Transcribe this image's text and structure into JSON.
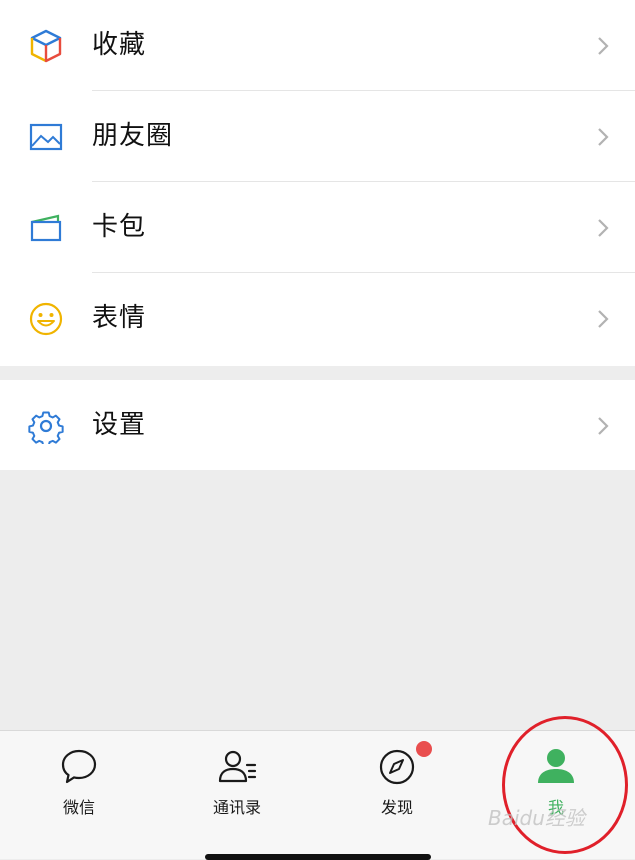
{
  "menu_group_1": [
    {
      "label": "收藏",
      "icon": "cube-icon"
    },
    {
      "label": "朋友圈",
      "icon": "image-icon"
    },
    {
      "label": "卡包",
      "icon": "card-icon"
    },
    {
      "label": "表情",
      "icon": "smiley-icon"
    }
  ],
  "menu_group_2": [
    {
      "label": "设置",
      "icon": "gear-icon"
    }
  ],
  "tabbar": {
    "tabs": [
      {
        "label": "微信",
        "icon": "chat-bubble-icon"
      },
      {
        "label": "通讯录",
        "icon": "contacts-icon"
      },
      {
        "label": "发现",
        "icon": "compass-icon",
        "badge": true
      },
      {
        "label": "我",
        "icon": "person-icon",
        "active": true
      }
    ]
  },
  "watermark": "Baidu经验",
  "colors": {
    "active_green": "#3fb15f",
    "badge_red": "#e94e4e",
    "annotation_red": "#e0202a",
    "icon_blue": "#2f7bd6",
    "icon_yellow": "#f0b400"
  }
}
